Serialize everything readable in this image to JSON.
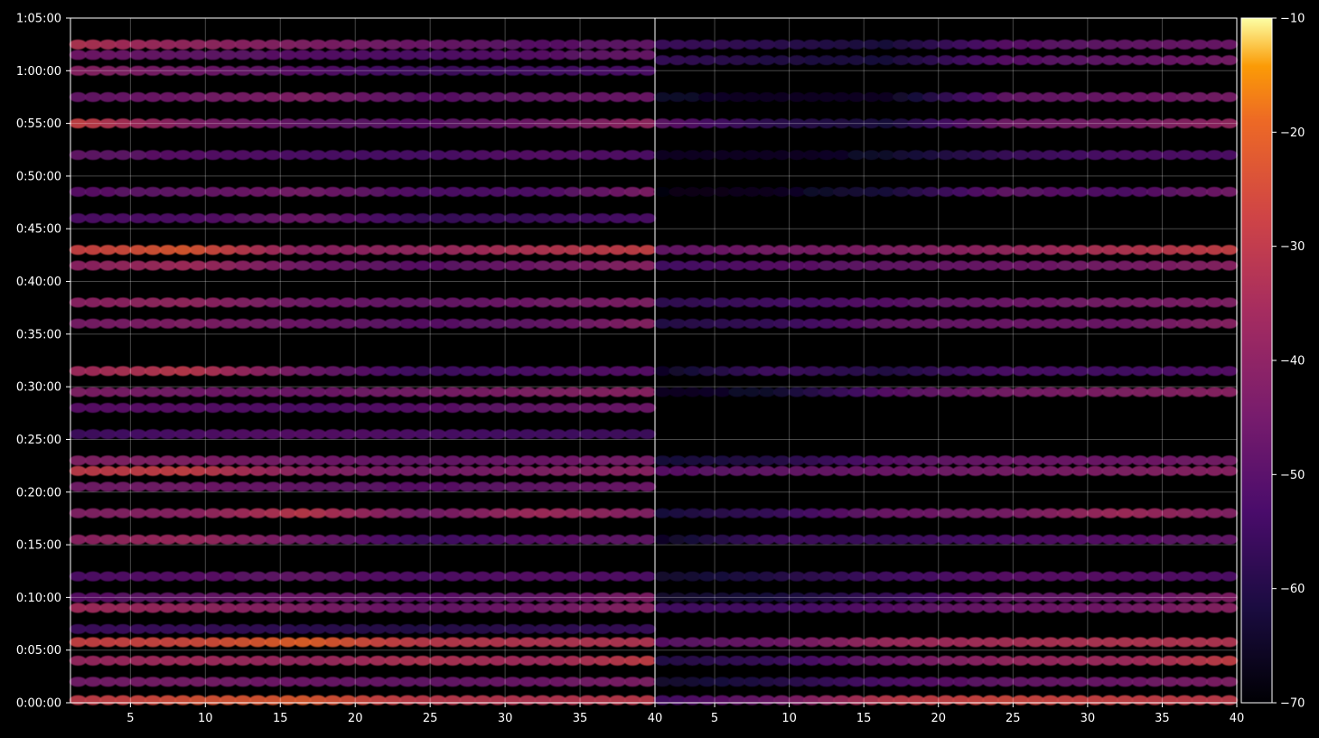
{
  "chart_data": {
    "type": "heatmap",
    "title": "",
    "xlabel": "",
    "ylabel": "",
    "colormap": "inferno",
    "background": "#000000",
    "grid": true,
    "panels": [
      {
        "name": "",
        "xlim": [
          1,
          40
        ],
        "x_ticks": [
          "5",
          "10",
          "15",
          "20",
          "25",
          "30",
          "35",
          "40"
        ],
        "bands": [
          {
            "t": "1:02:30",
            "strength": [
              -32,
              -38,
              -42,
              -46,
              -50,
              -48
            ]
          },
          {
            "t": "1:01:30",
            "strength": [
              -45,
              -48,
              -50,
              -52,
              -50,
              -47
            ]
          },
          {
            "t": "1:00:00",
            "strength": [
              -40,
              -45,
              -50,
              -55,
              -54,
              -52
            ]
          },
          {
            "t": "0:57:30",
            "strength": [
              -48,
              -45,
              -42,
              -50,
              -48,
              -46
            ]
          },
          {
            "t": "0:55:00",
            "strength": [
              -27,
              -42,
              -48,
              -50,
              -45,
              -38
            ]
          },
          {
            "t": "0:52:00",
            "strength": [
              -48,
              -50,
              -52,
              -53,
              -50,
              -52
            ]
          },
          {
            "t": "0:48:30",
            "strength": [
              -50,
              -48,
              -44,
              -52,
              -52,
              -42
            ]
          },
          {
            "t": "0:46:00",
            "strength": [
              -52,
              -52,
              -46,
              -56,
              -55,
              -52
            ]
          },
          {
            "t": "0:43:00",
            "strength": [
              -28,
              -22,
              -40,
              -38,
              -32,
              -28
            ]
          },
          {
            "t": "0:41:30",
            "strength": [
              -40,
              -35,
              -45,
              -50,
              -45,
              -40
            ]
          },
          {
            "t": "0:38:00",
            "strength": [
              -40,
              -38,
              -45,
              -48,
              -45,
              -42
            ]
          },
          {
            "t": "0:36:00",
            "strength": [
              -44,
              -42,
              -46,
              -50,
              -48,
              -40
            ]
          },
          {
            "t": "0:31:30",
            "strength": [
              -36,
              -30,
              -45,
              -55,
              -52,
              -50
            ]
          },
          {
            "t": "0:29:30",
            "strength": [
              -42,
              -45,
              -46,
              -44,
              -42,
              -40
            ]
          },
          {
            "t": "0:28:00",
            "strength": [
              -50,
              -50,
              -52,
              -50,
              -48,
              -46
            ]
          },
          {
            "t": "0:25:30",
            "strength": [
              -55,
              -52,
              -50,
              -52,
              -54,
              -55
            ]
          },
          {
            "t": "0:23:00",
            "strength": [
              -42,
              -42,
              -45,
              -48,
              -46,
              -44
            ]
          },
          {
            "t": "0:22:00",
            "strength": [
              -30,
              -28,
              -40,
              -45,
              -42,
              -40
            ]
          },
          {
            "t": "0:20:30",
            "strength": [
              -45,
              -45,
              -48,
              -50,
              -48,
              -46
            ]
          },
          {
            "t": "0:18:00",
            "strength": [
              -42,
              -40,
              -30,
              -45,
              -35,
              -42
            ]
          },
          {
            "t": "0:15:30",
            "strength": [
              -40,
              -36,
              -45,
              -55,
              -50,
              -48
            ]
          },
          {
            "t": "0:12:00",
            "strength": [
              -52,
              -50,
              -48,
              -52,
              -50,
              -52
            ]
          },
          {
            "t": "0:10:00",
            "strength": [
              -50,
              -48,
              -46,
              -50,
              -48,
              -42
            ]
          },
          {
            "t": "0:09:00",
            "strength": [
              -35,
              -38,
              -42,
              -48,
              -45,
              -40
            ]
          },
          {
            "t": "0:07:00",
            "strength": [
              -55,
              -56,
              -58,
              -60,
              -58,
              -56
            ]
          },
          {
            "t": "0:05:45",
            "strength": [
              -28,
              -26,
              -20,
              -30,
              -32,
              -32
            ]
          },
          {
            "t": "0:04:00",
            "strength": [
              -38,
              -35,
              -38,
              -32,
              -36,
              -28
            ]
          },
          {
            "t": "0:02:00",
            "strength": [
              -45,
              -44,
              -46,
              -48,
              -46,
              -42
            ]
          },
          {
            "t": "0:00:15",
            "strength": [
              -30,
              -24,
              -22,
              -30,
              -32,
              -30
            ]
          }
        ]
      },
      {
        "name": "",
        "xlim": [
          1,
          40
        ],
        "x_ticks": [
          "5",
          "10",
          "15",
          "20",
          "25",
          "30",
          "35",
          "40"
        ],
        "bands": [
          {
            "t": "1:02:30",
            "strength": [
              -55,
              -58,
              -62,
              -50,
              -48,
              -46
            ]
          },
          {
            "t": "1:01:00",
            "strength": [
              -56,
              -60,
              -62,
              -50,
              -48,
              -44
            ]
          },
          {
            "t": "0:57:30",
            "strength": [
              -64,
              -66,
              -66,
              -48,
              -46,
              -44
            ]
          },
          {
            "t": "0:55:00",
            "strength": [
              -48,
              -58,
              -62,
              -45,
              -44,
              -38
            ]
          },
          {
            "t": "0:52:00",
            "strength": [
              -66,
              -66,
              -64,
              -56,
              -52,
              -52
            ]
          },
          {
            "t": "0:48:30",
            "strength": [
              -68,
              -66,
              -62,
              -48,
              -52,
              -44
            ]
          },
          {
            "t": "0:43:00",
            "strength": [
              -48,
              -44,
              -42,
              -38,
              -32,
              -28
            ]
          },
          {
            "t": "0:41:30",
            "strength": [
              -54,
              -50,
              -48,
              -46,
              -44,
              -40
            ]
          },
          {
            "t": "0:38:00",
            "strength": [
              -58,
              -54,
              -50,
              -46,
              -44,
              -42
            ]
          },
          {
            "t": "0:36:00",
            "strength": [
              -60,
              -56,
              -48,
              -46,
              -46,
              -40
            ]
          },
          {
            "t": "0:31:30",
            "strength": [
              -66,
              -54,
              -60,
              -52,
              -54,
              -50
            ]
          },
          {
            "t": "0:29:30",
            "strength": [
              -66,
              -64,
              -50,
              -44,
              -42,
              -40
            ]
          },
          {
            "t": "0:23:00",
            "strength": [
              -62,
              -60,
              -50,
              -46,
              -46,
              -44
            ]
          },
          {
            "t": "0:22:00",
            "strength": [
              -50,
              -48,
              -46,
              -44,
              -42,
              -40
            ]
          },
          {
            "t": "0:18:00",
            "strength": [
              -62,
              -56,
              -46,
              -44,
              -35,
              -42
            ]
          },
          {
            "t": "0:15:30",
            "strength": [
              -66,
              -54,
              -56,
              -52,
              -50,
              -48
            ]
          },
          {
            "t": "0:12:00",
            "strength": [
              -64,
              -60,
              -54,
              -50,
              -50,
              -52
            ]
          },
          {
            "t": "0:10:00",
            "strength": [
              -64,
              -62,
              -56,
              -48,
              -48,
              -42
            ]
          },
          {
            "t": "0:09:00",
            "strength": [
              -54,
              -54,
              -50,
              -46,
              -45,
              -40
            ]
          },
          {
            "t": "0:05:45",
            "strength": [
              -50,
              -46,
              -36,
              -34,
              -32,
              -32
            ]
          },
          {
            "t": "0:04:00",
            "strength": [
              -60,
              -56,
              -46,
              -38,
              -36,
              -28
            ]
          },
          {
            "t": "0:02:00",
            "strength": [
              -64,
              -60,
              -52,
              -48,
              -46,
              -42
            ]
          },
          {
            "t": "0:00:15",
            "strength": [
              -54,
              -46,
              -30,
              -26,
              -28,
              -30
            ]
          }
        ]
      }
    ],
    "y_axis": {
      "range": [
        "0:00:00",
        "1:05:00"
      ],
      "ticks": [
        "0:00:00",
        "0:05:00",
        "0:10:00",
        "0:15:00",
        "0:20:00",
        "0:25:00",
        "0:30:00",
        "0:35:00",
        "0:40:00",
        "0:45:00",
        "0:50:00",
        "0:55:00",
        "1:00:00",
        "1:05:00"
      ]
    },
    "colorbar": {
      "range": [
        -70,
        -10
      ],
      "ticks": [
        "−10",
        "−20",
        "−30",
        "−40",
        "−50",
        "−60",
        "−70"
      ]
    }
  }
}
